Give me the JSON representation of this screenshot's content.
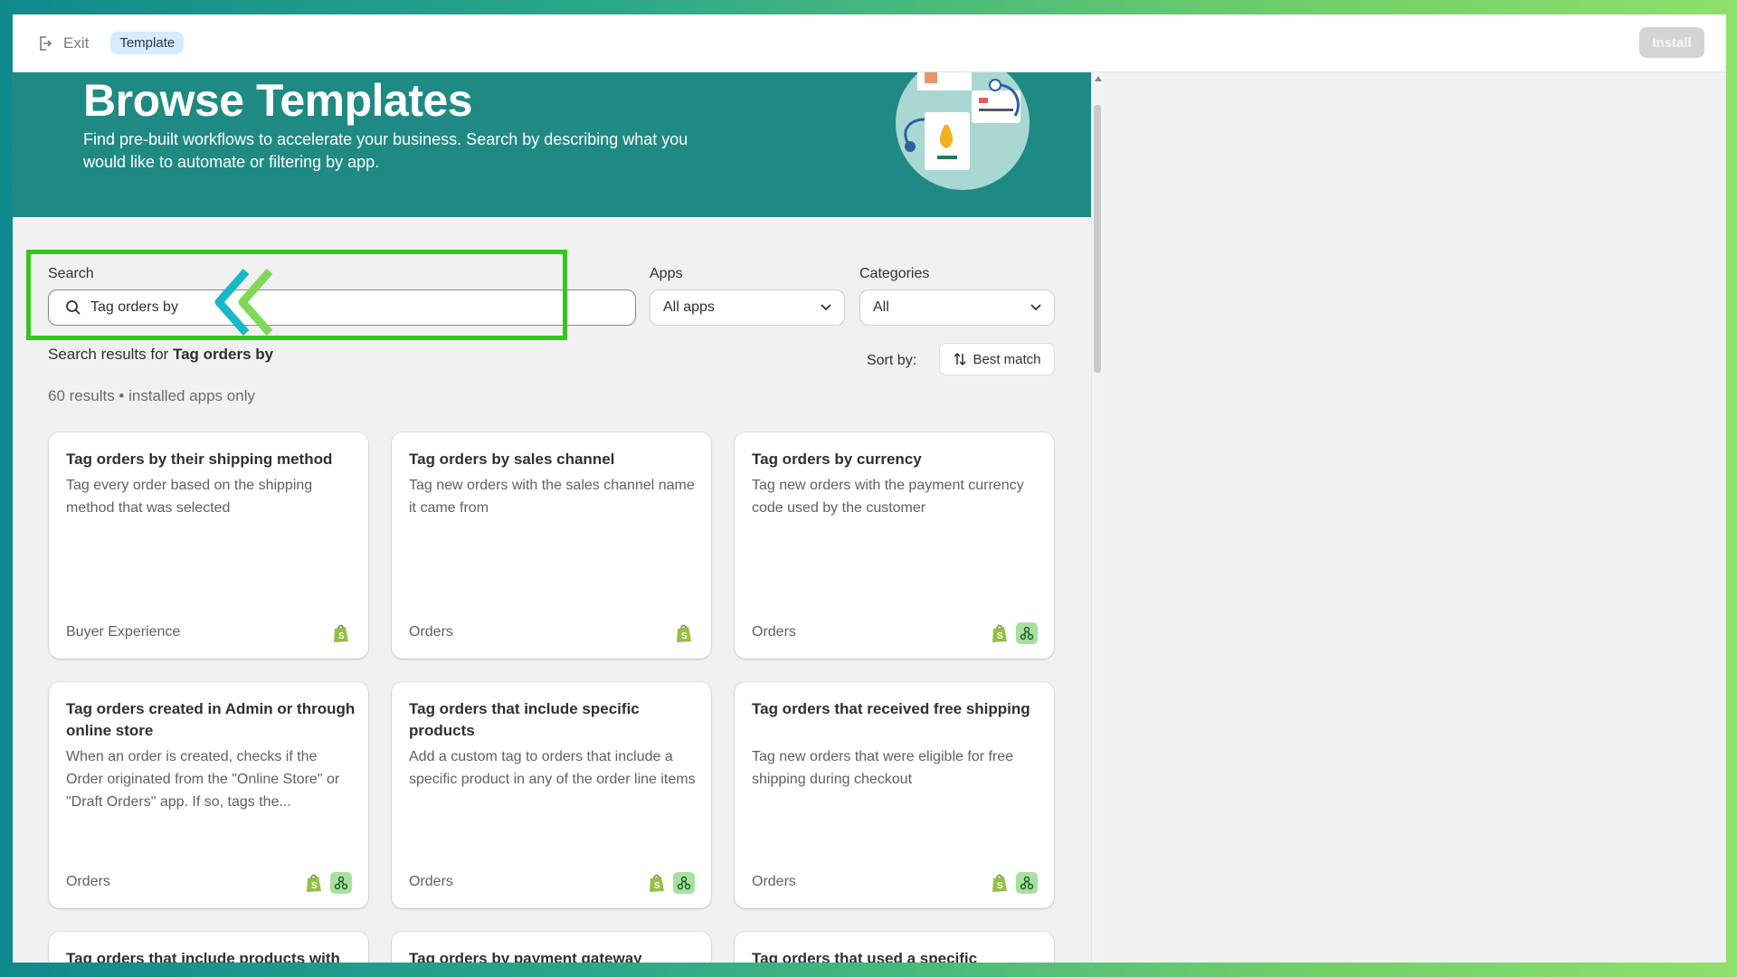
{
  "topbar": {
    "exit_label": "Exit",
    "badge": "Template",
    "install_label": "Install"
  },
  "hero": {
    "title": "Browse Templates",
    "subtitle": "Find pre-built workflows to accelerate your business. Search by describing what you would like to automate or filtering by app."
  },
  "filters": {
    "search_label": "Search",
    "search_value": "Tag orders by",
    "apps_label": "Apps",
    "apps_value": "All apps",
    "categories_label": "Categories",
    "categories_value": "All"
  },
  "results": {
    "prefix": "Search results for",
    "query": "Tag orders by",
    "count_text": "60 results • installed apps only",
    "sort_label": "Sort by:",
    "sort_value": "Best match"
  },
  "cards": [
    {
      "title": "Tag orders by their shipping method",
      "desc": "Tag every order based on the shipping method that was selected",
      "category": "Buyer Experience",
      "apps": [
        "shopify"
      ]
    },
    {
      "title": "Tag orders by sales channel",
      "desc": "Tag new orders with the sales channel name it came from",
      "category": "Orders",
      "apps": [
        "shopify"
      ]
    },
    {
      "title": "Tag orders by currency",
      "desc": "Tag new orders with the payment currency code used by the customer",
      "category": "Orders",
      "apps": [
        "shopify",
        "flow"
      ]
    },
    {
      "title": "Tag orders created in Admin or through online store",
      "desc": "When an order is created, checks if the Order originated from the \"Online Store\" or \"Draft Orders\" app. If so, tags the...",
      "category": "Orders",
      "apps": [
        "shopify",
        "flow"
      ]
    },
    {
      "title": "Tag orders that include specific products",
      "desc": "Add a custom tag to orders that include a specific product in any of the order line items",
      "category": "Orders",
      "apps": [
        "shopify",
        "flow"
      ]
    },
    {
      "title": "Tag orders that received free shipping",
      "desc": "Tag new orders that were eligible for free shipping during checkout",
      "category": "Orders",
      "apps": [
        "shopify",
        "flow"
      ]
    },
    {
      "title": "Tag orders that include products with",
      "desc": "",
      "category": "",
      "apps": []
    },
    {
      "title": "Tag orders by payment gateway",
      "desc": "",
      "category": "",
      "apps": []
    },
    {
      "title": "Tag orders that used a specific",
      "desc": "",
      "category": "",
      "apps": []
    }
  ],
  "colors": {
    "hero_bg": "#1f8a84",
    "highlight": "#35c61e",
    "badge_bg": "#d5ebff"
  }
}
